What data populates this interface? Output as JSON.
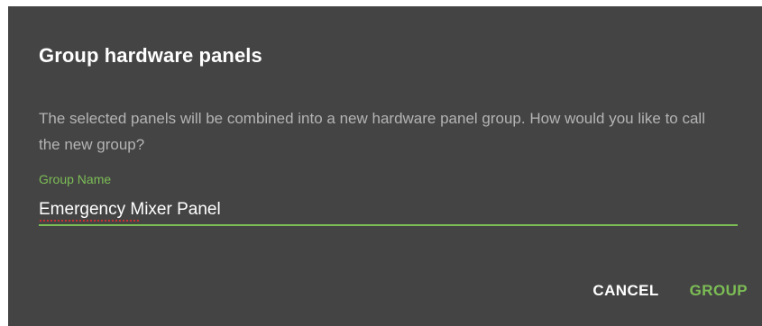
{
  "dialog": {
    "title": "Group hardware panels",
    "description": "The selected panels will be combined into a new hardware panel group. How would you like to call the new group?",
    "field": {
      "label": "Group Name",
      "value": "Emergency Mixer Panel",
      "misspelled_word": "Emergency"
    },
    "actions": {
      "cancel_label": "CANCEL",
      "group_label": "GROUP"
    }
  },
  "colors": {
    "dialog_background": "#444444",
    "accent": "#7cbd55",
    "title_text": "#ffffff",
    "body_text": "#b4b4b4",
    "spellcheck_underline": "#d23030"
  }
}
